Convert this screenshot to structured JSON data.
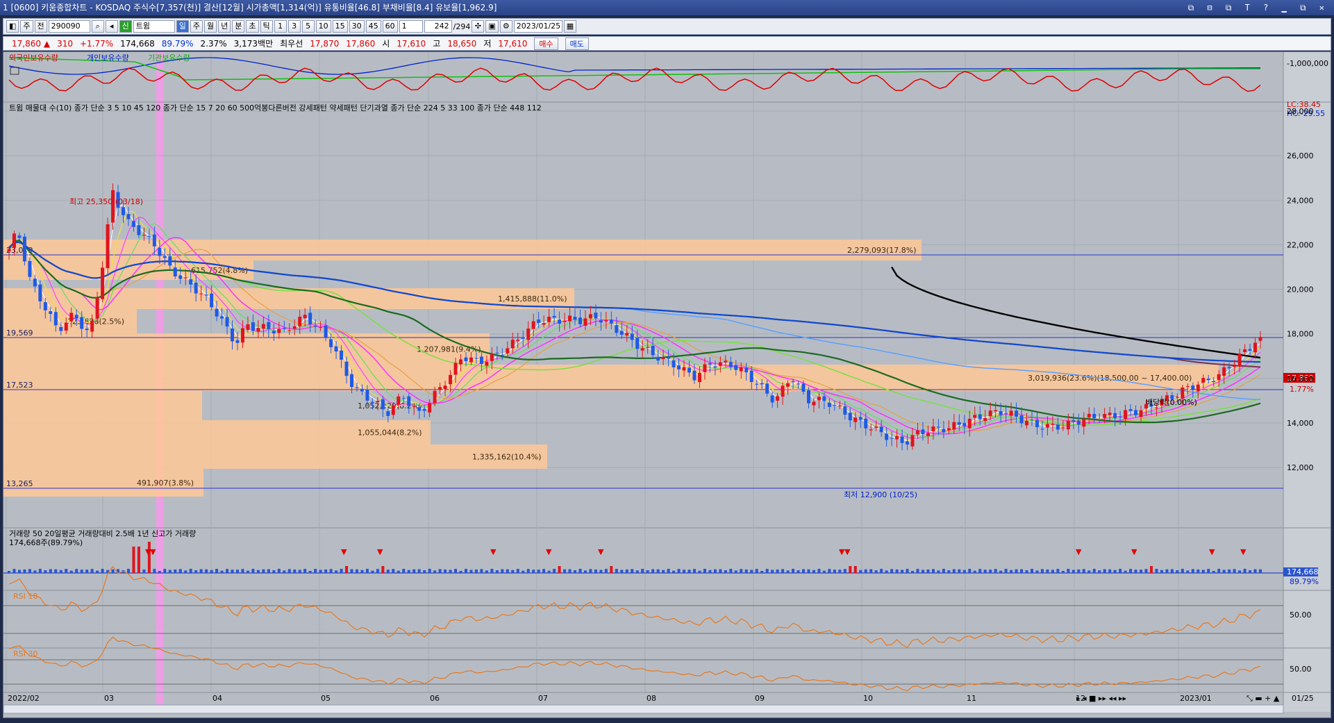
{
  "window": {
    "title": "[0600] 키움종합차트 - KOSDAQ 주식수[7,357(천)] 결산[12월] 시가총액[1,314(억)] 유통비율[46.8] 부채비율[8.4] 유보율[1,962.9]",
    "badge": "1",
    "controls": "⧉ ⊟ ⧉ T ? ▁ ⧉ ✕"
  },
  "toolbar": {
    "period": "주",
    "mode": "전",
    "code": "290090",
    "name": "트윔",
    "name_prefix": "신",
    "tabs": [
      "일",
      "주",
      "월",
      "년",
      "분",
      "초",
      "틱"
    ],
    "active_tab": "일",
    "intervals": [
      "1",
      "3",
      "5",
      "10",
      "15",
      "30",
      "45",
      "60"
    ],
    "unit": "1",
    "count": "242",
    "total": "/294",
    "date": "2023/01/25"
  },
  "info": {
    "price": "17,860",
    "arrow": "▲",
    "change": "310",
    "change_pct": "+1.77%",
    "volume": "174,668",
    "volume_pct": "89.79%",
    "turnover": "2.37%",
    "amount": "3,173백만",
    "bid_label": "최우선",
    "bid": "17,870",
    "ask": "17,860",
    "open_label": "시",
    "open": "17,610",
    "high_label": "고",
    "high": "18,650",
    "low_label": "저",
    "low": "17,610",
    "buy": "매수",
    "sell": "매도"
  },
  "legends": {
    "holdings": [
      "외국인보유수량",
      "개인보유수량",
      "기관보유수량"
    ],
    "price": [
      "트윔 매물대 수(10)",
      "종가 단순 3",
      "5",
      "10",
      "45",
      "120",
      "종가 단순 15",
      "7",
      "20",
      "60",
      "500억봉다른버전 강세패턴",
      "약세패턴",
      "단기과열",
      "종가 단순 224",
      "5",
      "33",
      "100",
      "종가 단순 448",
      "112"
    ],
    "volume": [
      "거래량",
      "50",
      "20일평균 거래량대비 2.5배",
      "1년 신고가 거래량"
    ],
    "volume_value": "174,668주(89.79%)",
    "rsi1": "RSI 18",
    "rsi2": "RSI 30"
  },
  "annotations": {
    "high": "최고 25,350 (03/18)",
    "low": "최저 12,900 (10/25)",
    "dividend": "배당락(0.00%)",
    "levels": [
      "23,059",
      "19,569",
      "17,523",
      "13,265"
    ],
    "profiles": [
      "2,279,093(17.8%)",
      "615,752(4.8%)",
      "1,415,888(11.0%)",
      "323,828(2.5%)",
      "1,207,981(9.4%)",
      "3,019,936(23.6%)(18,500.00 ~ 17,400.00)",
      "1,052,329(8.2%)",
      "1,055,044(8.2%)",
      "1,335,162(10.4%)",
      "491,907(3.8%)"
    ]
  },
  "right_axis": {
    "holdings_top": "-1,000,000",
    "lc": "LC:38.45",
    "hc": "HC:-29.55",
    "price_ticks": [
      "28,000",
      "26,000",
      "24,000",
      "22,000",
      "20,000",
      "18,000",
      "16,000",
      "14,000",
      "12,000"
    ],
    "price_box": "17,860",
    "price_pct": "1.77%",
    "volume_box": "174,668",
    "volume_pct": "89.79%",
    "rsi1_mid": "50.00",
    "rsi2_mid": "50.00"
  },
  "x_axis": {
    "labels": [
      "2022/02",
      "03",
      "04",
      "05",
      "06",
      "07",
      "08",
      "09",
      "10",
      "11",
      "12",
      "2023/01"
    ],
    "end_label": "01/25"
  },
  "colors": {
    "background": "#b7bcc4",
    "profile": "#ffc896",
    "up": "#e0141e",
    "down": "#1e5ae6",
    "highlight": "#ff96f0",
    "rsi": "#e8781e"
  }
}
